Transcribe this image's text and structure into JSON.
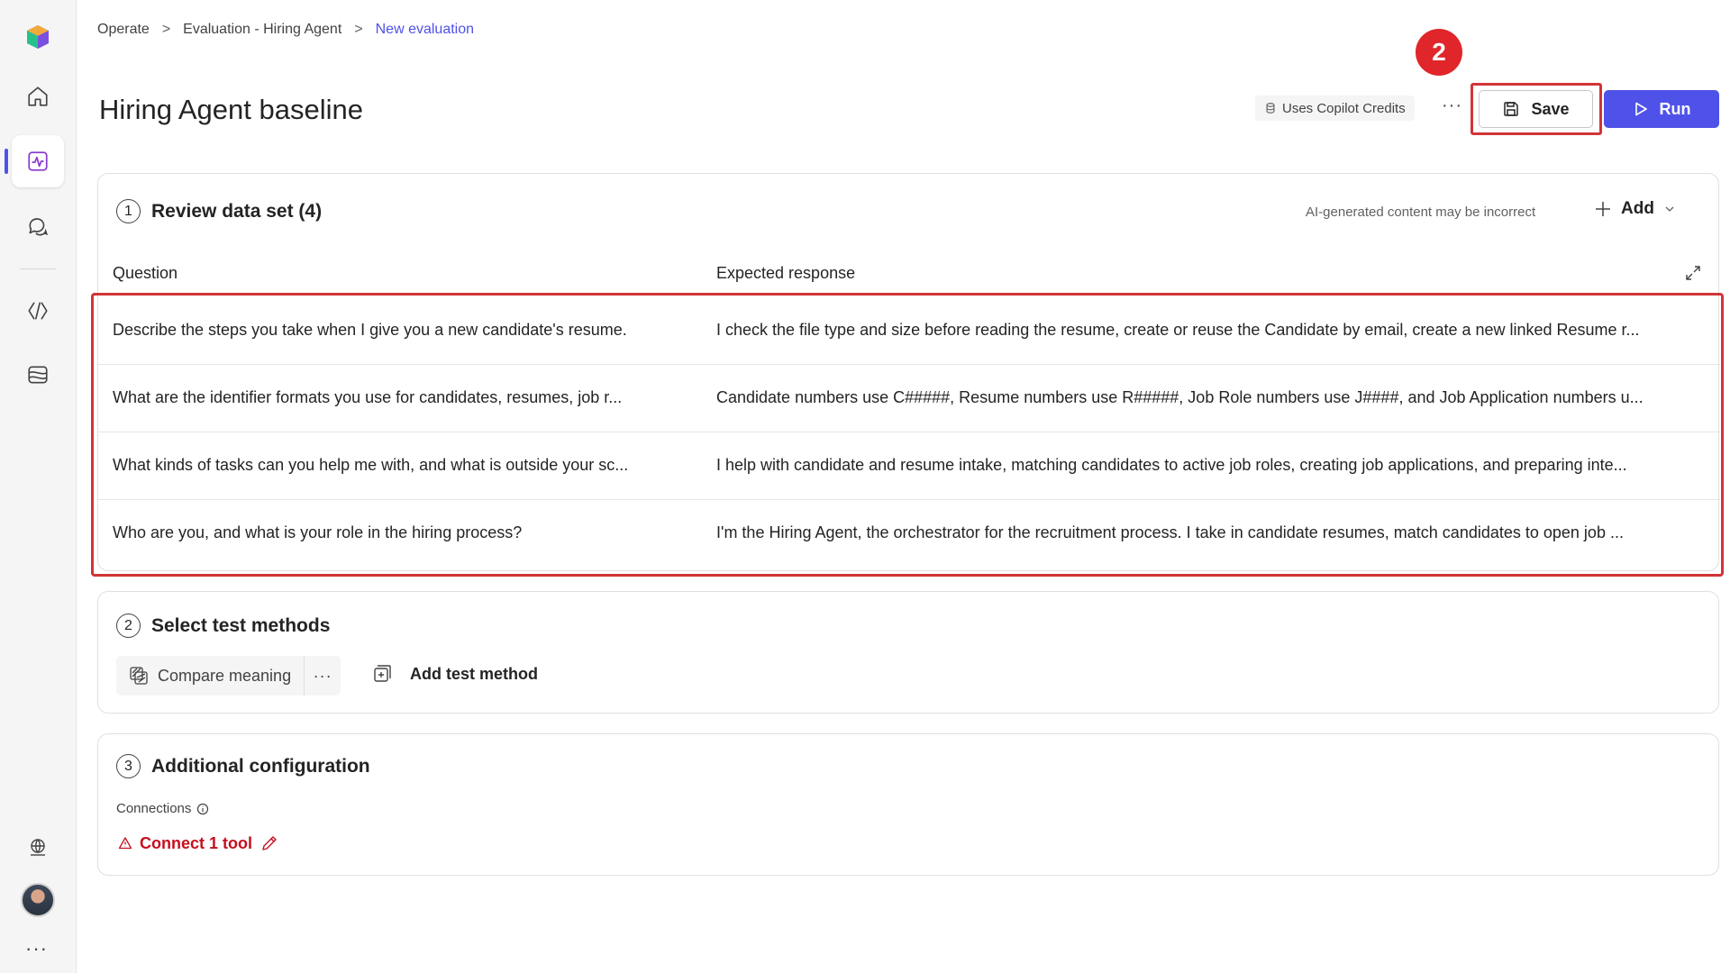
{
  "breadcrumb": {
    "items": [
      "Operate",
      "Evaluation - Hiring Agent"
    ],
    "current": "New evaluation",
    "separator": ">"
  },
  "header": {
    "title": "Hiring Agent baseline",
    "credits_label": "Uses Copilot Credits",
    "more_label": "···",
    "save_label": "Save",
    "run_label": "Run",
    "step_badge": "2"
  },
  "dataset": {
    "step": "1",
    "title": "Review data set (4)",
    "ai_note": "AI-generated content may be incorrect",
    "add_label": "Add",
    "columns": {
      "question": "Question",
      "expected": "Expected response"
    },
    "rows": [
      {
        "question": "Describe the steps you take when I give you a new candidate's resume.",
        "expected": "I check the file type and size before reading the resume, create or reuse the Candidate by email, create a new linked Resume r..."
      },
      {
        "question": "What are the identifier formats you use for candidates, resumes, job r...",
        "expected": "Candidate numbers use C#####, Resume numbers use R#####, Job Role numbers use J####, and Job Application numbers u..."
      },
      {
        "question": "What kinds of tasks can you help me with, and what is outside your sc...",
        "expected": "I help with candidate and resume intake, matching candidates to active job roles, creating job applications, and preparing inte..."
      },
      {
        "question": "Who are you, and what is your role in the hiring process?",
        "expected": "I'm the Hiring Agent, the orchestrator for the recruitment process. I take in candidate resumes, match candidates to open job ..."
      }
    ]
  },
  "methods": {
    "step": "2",
    "title": "Select test methods",
    "chip_label": "Compare meaning",
    "chip_more": "···",
    "add_label": "Add test method"
  },
  "config": {
    "step": "3",
    "title": "Additional configuration",
    "connections_label": "Connections",
    "connect_label": "Connect 1 tool"
  },
  "rail": {
    "more_label": "···"
  },
  "colors": {
    "accent": "#4f52e8",
    "highlight": "#d13438",
    "warning": "#c50f1f"
  }
}
